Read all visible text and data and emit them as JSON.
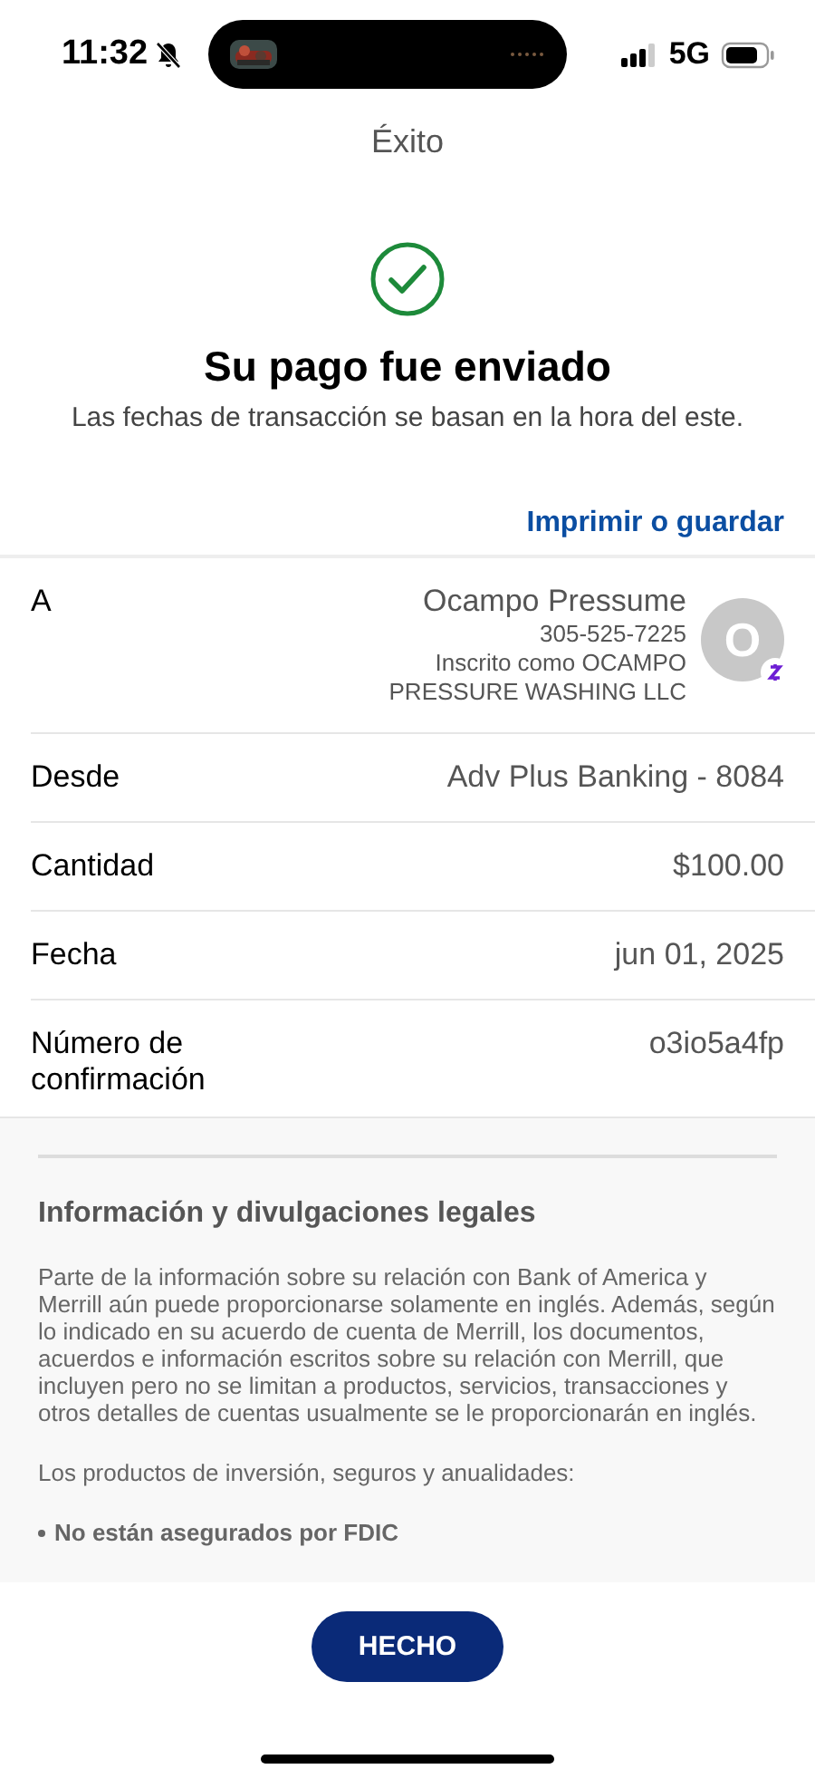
{
  "status_bar": {
    "time": "11:32",
    "network": "5G"
  },
  "header": {
    "title": "Éxito"
  },
  "result": {
    "heading": "Su pago fue enviado",
    "note": "Las fechas de transacción se basan en la hora del este."
  },
  "print_link": "Imprimir o guardar",
  "details": [
    {
      "kind": "recipient",
      "label": "A",
      "name": "Ocampo Pressume",
      "phone": "305-525-7225",
      "enrolled": "Inscrito como OCAMPO PRESSURE WASHING LLC",
      "initial": "O"
    },
    {
      "kind": "plain",
      "label": "Desde",
      "value": "Adv Plus Banking - 8084"
    },
    {
      "kind": "plain",
      "label": "Cantidad",
      "value": "$100.00"
    },
    {
      "kind": "plain",
      "label": "Fecha",
      "value": "jun 01, 2025"
    },
    {
      "kind": "plain",
      "label": "Número de confirmación",
      "value": "o3io5a4fp"
    }
  ],
  "legal": {
    "title": "Información y divulgaciones legales",
    "paragraphs": [
      "Parte de la información sobre su relación con Bank of America y Merrill aún puede proporcionarse solamente en inglés. Además, según lo indicado en su acuerdo de cuenta de Merrill, los documentos, acuerdos e información escritos sobre su relación con Merrill, que incluyen pero no se limitan a productos, servicios, transacciones y otros detalles de cuentas usualmente se le proporcionarán en inglés.",
      "Los productos de inversión, seguros y anualidades:"
    ],
    "bullets": [
      "No están asegurados por FDIC"
    ]
  },
  "done_button": "HECHO"
}
